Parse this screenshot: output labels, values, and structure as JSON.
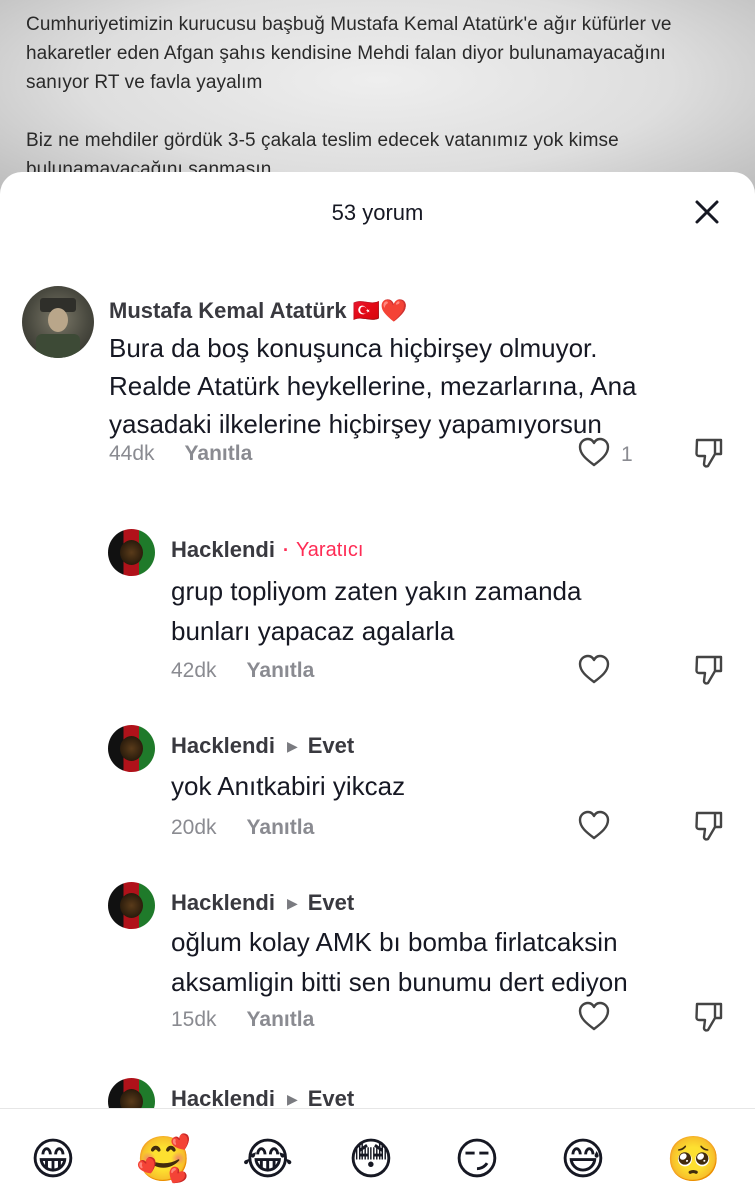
{
  "post": {
    "paragraph1": "Cumhuriyetimizin kurucusu başbuğ Mustafa Kemal Atatürk'e ağır küfürler ve hakaretler eden Afgan şahıs kendisine Mehdi falan diyor bulunamayacağını sanıyor RT ve favla yayalım",
    "paragraph2": "Biz ne mehdiler gördük 3-5 çakala teslim edecek vatanımız yok kimse bulunamayacağını sanmasın"
  },
  "sheet": {
    "comment_count": "53 yorum"
  },
  "comments": [
    {
      "username": "Mustafa Kemal Atatürk 🇹🇷❤️",
      "text_lines": [
        "Bura da boş konuşunca hiçbirşey olmuyor.",
        "Realde Atatürk heykellerine, mezarlarına, Ana",
        "yasadaki ilkelerine hiçbirşey yapamıyorsun"
      ],
      "time": "44dk",
      "reply_label": "Yanıtla",
      "likes": "1"
    },
    {
      "username": "Hacklendi",
      "creator_dot": "·",
      "creator_tag": "Yaratıcı",
      "text_lines": [
        "grup topliyom zaten yakın zamanda",
        "bunları yapacaz agalarla"
      ],
      "time": "42dk",
      "reply_label": "Yanıtla"
    },
    {
      "username": "Hacklendi",
      "reply_to": "Evet",
      "text_lines": [
        "yok Anıtkabiri yikcaz"
      ],
      "time": "20dk",
      "reply_label": "Yanıtla"
    },
    {
      "username": "Hacklendi",
      "reply_to": "Evet",
      "text_lines": [
        "oğlum kolay AMK bı bomba firlatcaksin",
        "aksamligin bitti sen bunumu dert ediyon"
      ],
      "time": "15dk",
      "reply_label": "Yanıtla"
    },
    {
      "username": "Hacklendi",
      "reply_to": "Evet"
    }
  ],
  "icons": {
    "close": "close-icon",
    "like": "heart-outline-icon",
    "dislike": "thumbs-down-icon",
    "reply_arrow": "triangle-right-icon"
  },
  "emoji_bar": [
    "😁",
    "🥰",
    "😂",
    "😳",
    "😏",
    "😅",
    "🥺"
  ],
  "colors": {
    "creator_accent": "#fe2c55",
    "text_primary": "#161823",
    "text_secondary": "#8a8b91"
  }
}
